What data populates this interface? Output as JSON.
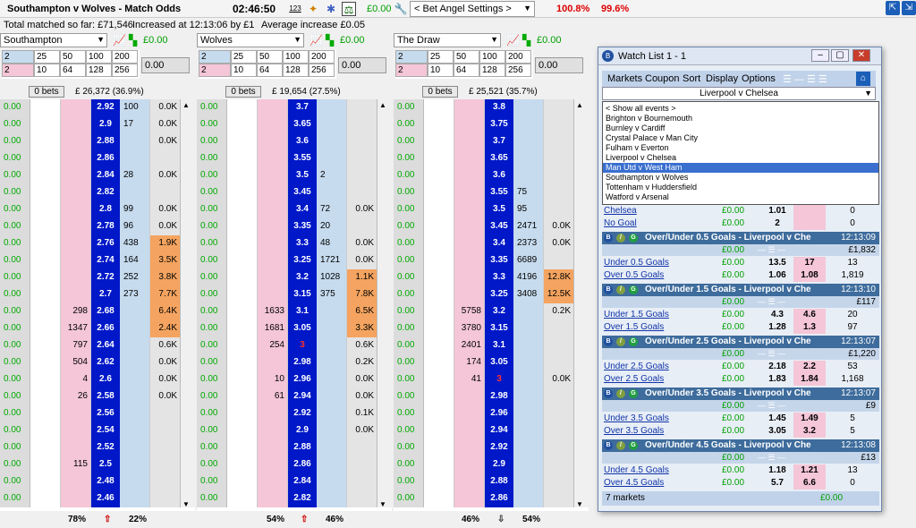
{
  "header": {
    "title": "Southampton v Wolves - Match Odds",
    "clock": "02:46:50",
    "icon_123": "123",
    "money": "£0.00",
    "settings": "< Bet Angel Settings >",
    "book_back": "100.8%",
    "book_lay": "99.6%"
  },
  "info": {
    "total_matched": "Total matched so far: £71,546",
    "increased": "Increased at 12:13:06 by £1",
    "avg_increase": "Average increase £0.05"
  },
  "stake_values": {
    "row1": [
      "2",
      "25",
      "50",
      "100",
      "200"
    ],
    "row1_2": "2",
    "row2": [
      "10",
      "64",
      "128",
      "256"
    ],
    "row2_2": "2",
    "stake_field": "0.00"
  },
  "panels": [
    {
      "selection": "Southampton",
      "money": "£0.00",
      "bets": "0 bets",
      "total": "£ 26,372 (36.9%)",
      "footer_left": "78%",
      "footer_right": "22%",
      "arrow": "up",
      "rows": [
        [
          "0.00",
          "",
          "",
          "2.92",
          "100",
          "0.0K"
        ],
        [
          "0.00",
          "",
          "",
          "2.9",
          "17",
          "0.0K"
        ],
        [
          "0.00",
          "",
          "",
          "2.88",
          "",
          "0.0K"
        ],
        [
          "0.00",
          "",
          "",
          "2.86",
          "",
          ""
        ],
        [
          "0.00",
          "",
          "",
          "2.84",
          "28",
          "0.0K"
        ],
        [
          "0.00",
          "",
          "",
          "2.82",
          "",
          ""
        ],
        [
          "0.00",
          "",
          "",
          "2.8",
          "99",
          "0.0K"
        ],
        [
          "0.00",
          "",
          "",
          "2.78",
          "96",
          "0.0K"
        ],
        [
          "0.00",
          "",
          "",
          "2.76",
          "438",
          "1.9K"
        ],
        [
          "0.00",
          "",
          "",
          "2.74",
          "164",
          "3.5K"
        ],
        [
          "0.00",
          "",
          "",
          "2.72",
          "252",
          "3.8K"
        ],
        [
          "0.00",
          "",
          "",
          "2.7",
          "273",
          "7.7K"
        ],
        [
          "0.00",
          "",
          "298",
          "2.68",
          "",
          "6.4K"
        ],
        [
          "0.00",
          "",
          "1347",
          "2.66",
          "",
          "2.4K"
        ],
        [
          "0.00",
          "",
          "797",
          "2.64",
          "",
          "0.6K"
        ],
        [
          "0.00",
          "",
          "504",
          "2.62",
          "",
          "0.0K"
        ],
        [
          "0.00",
          "",
          "4",
          "2.6",
          "",
          "0.0K"
        ],
        [
          "0.00",
          "",
          "26",
          "2.58",
          "",
          "0.0K"
        ],
        [
          "0.00",
          "",
          "",
          "2.56",
          "",
          ""
        ],
        [
          "0.00",
          "",
          "",
          "2.54",
          "",
          ""
        ],
        [
          "0.00",
          "",
          "",
          "2.52",
          "",
          ""
        ],
        [
          "0.00",
          "",
          "115",
          "2.5",
          "",
          ""
        ],
        [
          "0.00",
          "",
          "",
          "2.48",
          "",
          ""
        ],
        [
          "0.00",
          "",
          "",
          "2.46",
          "",
          ""
        ]
      ]
    },
    {
      "selection": "Wolves",
      "money": "£0.00",
      "bets": "0 bets",
      "total": "£ 19,654 (27.5%)",
      "footer_left": "54%",
      "footer_right": "46%",
      "arrow": "up",
      "rows": [
        [
          "0.00",
          "",
          "",
          "3.7",
          "",
          ""
        ],
        [
          "0.00",
          "",
          "",
          "3.65",
          "",
          ""
        ],
        [
          "0.00",
          "",
          "",
          "3.6",
          "",
          ""
        ],
        [
          "0.00",
          "",
          "",
          "3.55",
          "",
          ""
        ],
        [
          "0.00",
          "",
          "",
          "3.5",
          "2",
          ""
        ],
        [
          "0.00",
          "",
          "",
          "3.45",
          "",
          ""
        ],
        [
          "0.00",
          "",
          "",
          "3.4",
          "72",
          "0.0K"
        ],
        [
          "0.00",
          "",
          "",
          "3.35",
          "20",
          ""
        ],
        [
          "0.00",
          "",
          "",
          "3.3",
          "48",
          "0.0K"
        ],
        [
          "0.00",
          "",
          "",
          "3.25",
          "1721",
          "0.0K"
        ],
        [
          "0.00",
          "",
          "",
          "3.2",
          "1028",
          "1.1K"
        ],
        [
          "0.00",
          "",
          "",
          "3.15",
          "375",
          "7.8K"
        ],
        [
          "0.00",
          "",
          "1633",
          "3.1",
          "",
          "6.5K"
        ],
        [
          "0.00",
          "",
          "1681",
          "3.05",
          "",
          "3.3K"
        ],
        [
          "0.00",
          "",
          "254",
          "3",
          "",
          "0.6K"
        ],
        [
          "0.00",
          "",
          "",
          "2.98",
          "",
          "0.2K"
        ],
        [
          "0.00",
          "",
          "10",
          "2.96",
          "",
          "0.0K"
        ],
        [
          "0.00",
          "",
          "61",
          "2.94",
          "",
          "0.0K"
        ],
        [
          "0.00",
          "",
          "",
          "2.92",
          "",
          "0.1K"
        ],
        [
          "0.00",
          "",
          "",
          "2.9",
          "",
          "0.0K"
        ],
        [
          "0.00",
          "",
          "",
          "2.88",
          "",
          ""
        ],
        [
          "0.00",
          "",
          "",
          "2.86",
          "",
          ""
        ],
        [
          "0.00",
          "",
          "",
          "2.84",
          "",
          ""
        ],
        [
          "0.00",
          "",
          "",
          "2.82",
          "",
          ""
        ]
      ]
    },
    {
      "selection": "The Draw",
      "money": "£0.00",
      "bets": "0 bets",
      "total": "£ 25,521 (35.7%)",
      "footer_left": "46%",
      "footer_right": "54%",
      "arrow": "down",
      "rows": [
        [
          "0.00",
          "",
          "",
          "3.8",
          "",
          ""
        ],
        [
          "0.00",
          "",
          "",
          "3.75",
          "",
          ""
        ],
        [
          "0.00",
          "",
          "",
          "3.7",
          "",
          ""
        ],
        [
          "0.00",
          "",
          "",
          "3.65",
          "",
          ""
        ],
        [
          "0.00",
          "",
          "",
          "3.6",
          "",
          ""
        ],
        [
          "0.00",
          "",
          "",
          "3.55",
          "75",
          ""
        ],
        [
          "0.00",
          "",
          "",
          "3.5",
          "95",
          ""
        ],
        [
          "0.00",
          "",
          "",
          "3.45",
          "2471",
          "0.0K"
        ],
        [
          "0.00",
          "",
          "",
          "3.4",
          "2373",
          "0.0K"
        ],
        [
          "0.00",
          "",
          "",
          "3.35",
          "6689",
          ""
        ],
        [
          "0.00",
          "",
          "",
          "3.3",
          "4196",
          "12.8K"
        ],
        [
          "0.00",
          "",
          "",
          "3.25",
          "3408",
          "12.5K"
        ],
        [
          "0.00",
          "",
          "5758",
          "3.2",
          "",
          "0.2K"
        ],
        [
          "0.00",
          "",
          "3780",
          "3.15",
          "",
          ""
        ],
        [
          "0.00",
          "",
          "2401",
          "3.1",
          "",
          ""
        ],
        [
          "0.00",
          "",
          "174",
          "3.05",
          "",
          ""
        ],
        [
          "0.00",
          "",
          "41",
          "3",
          "",
          "0.0K"
        ],
        [
          "0.00",
          "",
          "",
          "2.98",
          "",
          ""
        ],
        [
          "0.00",
          "",
          "",
          "2.96",
          "",
          ""
        ],
        [
          "0.00",
          "",
          "",
          "2.94",
          "",
          ""
        ],
        [
          "0.00",
          "",
          "",
          "2.92",
          "",
          ""
        ],
        [
          "0.00",
          "",
          "",
          "2.9",
          "",
          ""
        ],
        [
          "0.00",
          "",
          "",
          "2.88",
          "",
          ""
        ],
        [
          "0.00",
          "",
          "",
          "2.86",
          "",
          ""
        ]
      ]
    }
  ],
  "watchlist": {
    "title": "Watch List 1 - 1",
    "menu": [
      "Markets",
      "Coupon",
      "Sort",
      "Display",
      "Options"
    ],
    "selected_event": "Liverpool v Chelsea",
    "events": [
      "< Show all events >",
      "Brighton v Bournemouth",
      "Burnley v Cardiff",
      "Crystal Palace v Man City",
      "Fulham v Everton",
      "Liverpool v Chelsea",
      "Man Utd v West Ham",
      "Southampton v Wolves",
      "Tottenham v Huddersfield",
      "Watford v Arsenal"
    ],
    "highlighted_event": "Man Utd v West Ham",
    "top_rows": [
      {
        "name": "Chelsea",
        "pl": "£0.00",
        "back": "1.01",
        "lay": "",
        "vol": "0"
      },
      {
        "name": "No Goal",
        "pl": "£0.00",
        "back": "2",
        "lay": "",
        "vol": "0"
      }
    ],
    "markets": [
      {
        "title": "Over/Under 0.5 Goals - Liverpool v Che",
        "time": "12:13:09",
        "pl": "£0.00",
        "total": "£1,832",
        "rows": [
          {
            "name": "Under 0.5 Goals",
            "pl": "£0.00",
            "back": "13.5",
            "lay": "17",
            "vol": "13"
          },
          {
            "name": "Over 0.5 Goals",
            "pl": "£0.00",
            "back": "1.06",
            "lay": "1.08",
            "vol": "1,819"
          }
        ]
      },
      {
        "title": "Over/Under 1.5 Goals - Liverpool v Che",
        "time": "12:13:10",
        "pl": "£0.00",
        "total": "£117",
        "rows": [
          {
            "name": "Under 1.5 Goals",
            "pl": "£0.00",
            "back": "4.3",
            "lay": "4.6",
            "vol": "20"
          },
          {
            "name": "Over 1.5 Goals",
            "pl": "£0.00",
            "back": "1.28",
            "lay": "1.3",
            "vol": "97"
          }
        ]
      },
      {
        "title": "Over/Under 2.5 Goals - Liverpool v Che",
        "time": "12:13:07",
        "pl": "£0.00",
        "total": "£1,220",
        "rows": [
          {
            "name": "Under 2.5 Goals",
            "pl": "£0.00",
            "back": "2.18",
            "lay": "2.2",
            "vol": "53"
          },
          {
            "name": "Over 2.5 Goals",
            "pl": "£0.00",
            "back": "1.83",
            "lay": "1.84",
            "vol": "1,168"
          }
        ]
      },
      {
        "title": "Over/Under 3.5 Goals - Liverpool v Che",
        "time": "12:13:07",
        "pl": "£0.00",
        "total": "£9",
        "rows": [
          {
            "name": "Under 3.5 Goals",
            "pl": "£0.00",
            "back": "1.45",
            "lay": "1.49",
            "vol": "5"
          },
          {
            "name": "Over 3.5 Goals",
            "pl": "£0.00",
            "back": "3.05",
            "lay": "3.2",
            "vol": "5"
          }
        ]
      },
      {
        "title": "Over/Under 4.5 Goals - Liverpool v Che",
        "time": "12:13:08",
        "pl": "£0.00",
        "total": "£13",
        "rows": [
          {
            "name": "Under 4.5 Goals",
            "pl": "£0.00",
            "back": "1.18",
            "lay": "1.21",
            "vol": "13"
          },
          {
            "name": "Over 4.5 Goals",
            "pl": "£0.00",
            "back": "5.7",
            "lay": "6.6",
            "vol": "0"
          }
        ]
      }
    ],
    "footer_count": "7 markets",
    "footer_money": "£0.00"
  },
  "colors": {
    "price": "#0018c8",
    "back": "#f4c6d7",
    "lay": "#c6dbee",
    "highvol": "#f4a460",
    "profit": "#00a000"
  }
}
